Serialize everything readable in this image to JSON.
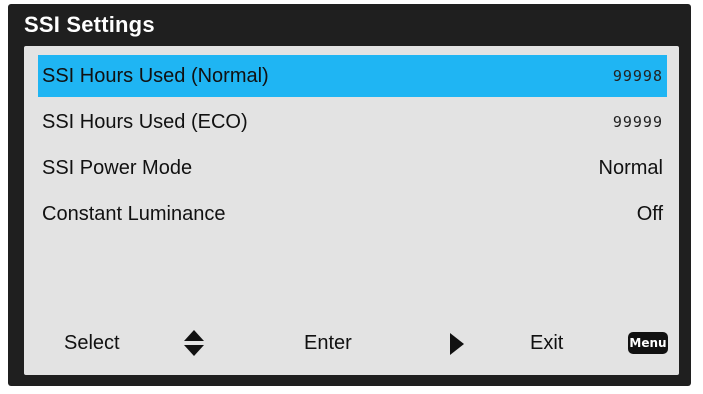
{
  "window": {
    "title": "SSI Settings"
  },
  "menu": {
    "items": [
      {
        "label": "SSI Hours Used (Normal)",
        "value": "99998",
        "selected": true
      },
      {
        "label": "SSI Hours Used (ECO)",
        "value": "99999",
        "selected": false
      },
      {
        "label": "SSI Power Mode",
        "value": "Normal",
        "selected": false
      },
      {
        "label": "Constant Luminance",
        "value": "Off",
        "selected": false
      }
    ]
  },
  "footer": {
    "select_label": "Select",
    "enter_label": "Enter",
    "exit_label": "Exit",
    "menu_badge": "Menu"
  },
  "colors": {
    "highlight": "#1fb5f3",
    "panel": "#e3e3e3",
    "frame": "#1f1f1f"
  },
  "icons": [
    "up-down-arrows-icon",
    "right-arrow-icon",
    "menu-button-icon"
  ]
}
